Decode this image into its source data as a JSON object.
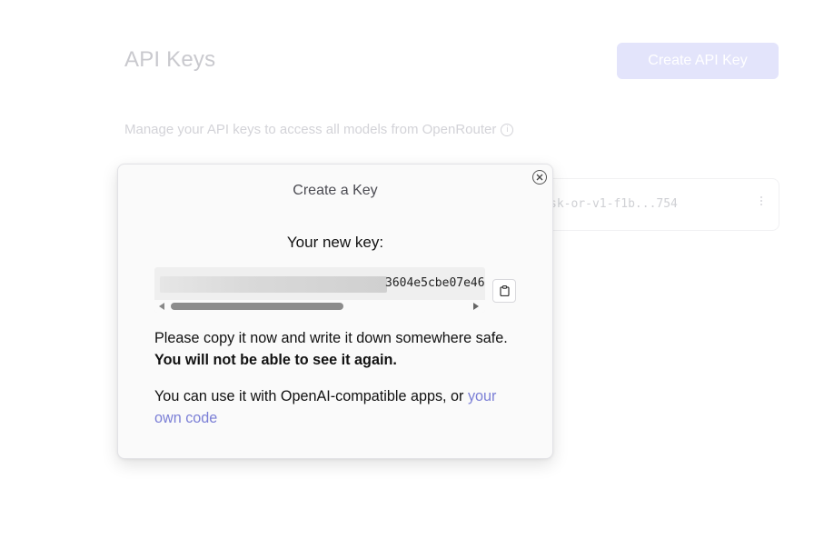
{
  "background": {
    "page_title": "API Keys",
    "create_button_label": "Create API Key",
    "description": "Manage your API keys to access all models from OpenRouter",
    "info_icon": "info-icon",
    "key_row": {
      "key_preview": "sk-or-v1-f1b...754",
      "menu_icon": "kebab-menu-icon"
    }
  },
  "modal": {
    "title": "Create a Key",
    "close_icon": "close-circle-icon",
    "new_key_label": "Your new key:",
    "key_visible_text": "3604e5cbe07e46",
    "copy_icon": "clipboard-icon",
    "warning_text": "Please copy it now and write it down somewhere safe. ",
    "warning_bold": "You will not be able to see it again.",
    "usage_text": "You can use it with OpenAI-compatible apps, or ",
    "usage_link": "your own code"
  },
  "colors": {
    "accent_link": "#7b7fd6",
    "button_bg": "#e3e4fb",
    "modal_bg": "#fafafa"
  }
}
